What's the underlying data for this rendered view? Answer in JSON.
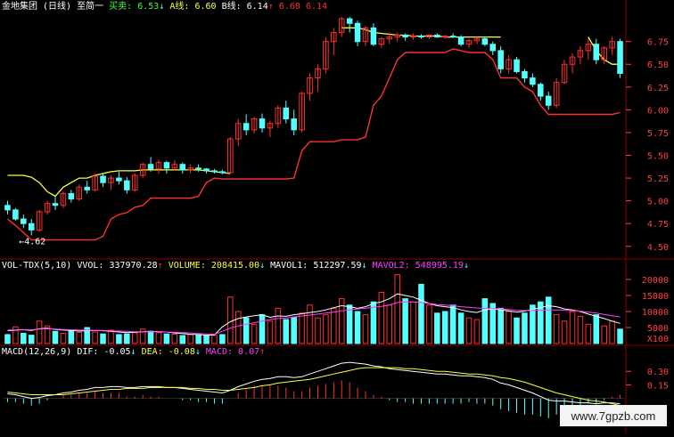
{
  "header": {
    "stock": "金地集团",
    "period": "(日线)",
    "indicator": "至简一",
    "buy_label": "买卖:",
    "buy_value": "6.53",
    "a_label": "A线:",
    "a_value": "6.60",
    "b_label": "B线:",
    "b_value": "6.14",
    "extra1": "6.60",
    "extra2": "6.14"
  },
  "vol_header": {
    "name": "VOL-TDX(5,10)",
    "vvol_label": "VVOL:",
    "vvol_value": "337970.28",
    "volume_label": "VOLUME:",
    "volume_value": "208415.00",
    "mavol1_label": "MAVOL1:",
    "mavol1_value": "512297.59",
    "mavol2_label": "MAVOL2:",
    "mavol2_value": "548995.19"
  },
  "macd_header": {
    "name": "MACD(12,26,9)",
    "dif_label": "DIF:",
    "dif_value": "-0.05",
    "dea_label": "DEA:",
    "dea_value": "-0.08",
    "macd_label": "MACD:",
    "macd_value": "0.07"
  },
  "annotation_low": "4.62",
  "watermark": "www.7gpzb.com",
  "colors": {
    "up": "#ff3030",
    "down": "#54ffff",
    "panel_line": "#8b0000",
    "yellow": "#ffff40",
    "white": "#ffffff",
    "magenta": "#ff40ff",
    "green": "#40ff40",
    "axis_text": "#ff4040"
  },
  "chart_data": [
    {
      "type": "candlestick",
      "panel": "price",
      "yticks": [
        "4.50",
        "4.75",
        "5.00",
        "5.25",
        "5.50",
        "5.75",
        "6.00",
        "6.25",
        "6.50",
        "6.75"
      ],
      "ylim": [
        4.4,
        7.05
      ],
      "ohlc": [
        [
          4.95,
          5.0,
          4.85,
          4.9
        ],
        [
          4.9,
          4.92,
          4.78,
          4.8
        ],
        [
          4.8,
          4.85,
          4.7,
          4.75
        ],
        [
          4.75,
          4.8,
          4.62,
          4.68
        ],
        [
          4.68,
          4.9,
          4.66,
          4.88
        ],
        [
          4.88,
          5.0,
          4.85,
          4.97
        ],
        [
          4.97,
          5.05,
          4.9,
          4.95
        ],
        [
          4.95,
          5.1,
          4.92,
          5.08
        ],
        [
          5.08,
          5.12,
          4.98,
          5.02
        ],
        [
          5.02,
          5.18,
          5.0,
          5.15
        ],
        [
          5.15,
          5.22,
          5.08,
          5.12
        ],
        [
          5.12,
          5.3,
          5.1,
          5.27
        ],
        [
          5.27,
          5.3,
          5.15,
          5.2
        ],
        [
          5.2,
          5.28,
          5.12,
          5.25
        ],
        [
          5.25,
          5.32,
          5.18,
          5.22
        ],
        [
          5.22,
          5.26,
          5.08,
          5.12
        ],
        [
          5.12,
          5.3,
          5.1,
          5.28
        ],
        [
          5.28,
          5.42,
          5.25,
          5.4
        ],
        [
          5.4,
          5.48,
          5.32,
          5.35
        ],
        [
          5.35,
          5.45,
          5.3,
          5.42
        ],
        [
          5.42,
          5.44,
          5.3,
          5.36
        ],
        [
          5.36,
          5.45,
          5.33,
          5.4
        ],
        [
          5.4,
          5.42,
          5.3,
          5.34
        ],
        [
          5.34,
          5.4,
          5.3,
          5.36
        ],
        [
          5.36,
          5.4,
          5.32,
          5.35
        ],
        [
          5.35,
          5.36,
          5.3,
          5.33
        ],
        [
          5.33,
          5.35,
          5.3,
          5.32
        ],
        [
          5.32,
          5.34,
          5.29,
          5.31
        ],
        [
          5.31,
          5.7,
          5.3,
          5.68
        ],
        [
          5.68,
          5.9,
          5.6,
          5.85
        ],
        [
          5.85,
          5.95,
          5.72,
          5.78
        ],
        [
          5.78,
          5.92,
          5.74,
          5.9
        ],
        [
          5.9,
          5.96,
          5.75,
          5.8
        ],
        [
          5.8,
          5.88,
          5.7,
          5.85
        ],
        [
          5.85,
          6.05,
          5.8,
          6.02
        ],
        [
          6.02,
          6.1,
          5.85,
          5.9
        ],
        [
          5.9,
          6.0,
          5.72,
          5.78
        ],
        [
          5.78,
          6.2,
          5.75,
          6.18
        ],
        [
          6.18,
          6.4,
          6.1,
          6.35
        ],
        [
          6.35,
          6.5,
          6.2,
          6.45
        ],
        [
          6.45,
          6.8,
          6.4,
          6.75
        ],
        [
          6.75,
          6.9,
          6.6,
          6.85
        ],
        [
          6.85,
          7.02,
          6.8,
          7.0
        ],
        [
          7.0,
          7.02,
          6.85,
          6.95
        ],
        [
          6.95,
          6.98,
          6.7,
          6.75
        ],
        [
          6.75,
          6.92,
          6.7,
          6.9
        ],
        [
          6.9,
          6.95,
          6.7,
          6.72
        ],
        [
          6.72,
          6.8,
          6.68,
          6.78
        ],
        [
          6.78,
          6.85,
          6.72,
          6.8
        ],
        [
          6.8,
          6.85,
          6.75,
          6.82
        ],
        [
          6.82,
          6.84,
          6.76,
          6.8
        ],
        [
          6.8,
          6.84,
          6.77,
          6.81
        ],
        [
          6.81,
          6.83,
          6.78,
          6.8
        ],
        [
          6.8,
          6.83,
          6.78,
          6.82
        ],
        [
          6.82,
          6.84,
          6.79,
          6.8
        ],
        [
          6.8,
          6.82,
          6.78,
          6.81
        ],
        [
          6.81,
          6.84,
          6.79,
          6.8
        ],
        [
          6.8,
          6.82,
          6.7,
          6.72
        ],
        [
          6.72,
          6.78,
          6.68,
          6.76
        ],
        [
          6.76,
          6.8,
          6.72,
          6.78
        ],
        [
          6.78,
          6.8,
          6.7,
          6.72
        ],
        [
          6.72,
          6.75,
          6.6,
          6.65
        ],
        [
          6.65,
          6.7,
          6.4,
          6.45
        ],
        [
          6.45,
          6.6,
          6.4,
          6.55
        ],
        [
          6.55,
          6.58,
          6.4,
          6.42
        ],
        [
          6.42,
          6.45,
          6.3,
          6.35
        ],
        [
          6.35,
          6.4,
          6.25,
          6.28
        ],
        [
          6.28,
          6.3,
          6.1,
          6.15
        ],
        [
          6.15,
          6.2,
          6.0,
          6.05
        ],
        [
          6.05,
          6.35,
          6.02,
          6.3
        ],
        [
          6.3,
          6.55,
          6.28,
          6.5
        ],
        [
          6.5,
          6.62,
          6.4,
          6.58
        ],
        [
          6.58,
          6.7,
          6.5,
          6.65
        ],
        [
          6.65,
          6.78,
          6.55,
          6.72
        ],
        [
          6.72,
          6.78,
          6.5,
          6.55
        ],
        [
          6.55,
          6.7,
          6.5,
          6.68
        ],
        [
          6.68,
          6.8,
          6.6,
          6.75
        ],
        [
          6.75,
          6.78,
          6.35,
          6.4
        ]
      ],
      "a_line": [
        5.28,
        5.28,
        5.28,
        5.26,
        5.2,
        5.1,
        5.05,
        5.15,
        5.2,
        5.25,
        5.25,
        5.28,
        5.3,
        5.32,
        5.33,
        5.33,
        5.33,
        5.34,
        5.34,
        5.34,
        5.34,
        5.34,
        5.34,
        5.34,
        5.34,
        5.33,
        5.32,
        5.31,
        5.3,
        null,
        null,
        null,
        null,
        null,
        null,
        null,
        null,
        null,
        null,
        null,
        null,
        null,
        6.9,
        6.9,
        6.9,
        6.88,
        6.85,
        6.84,
        6.83,
        6.82,
        6.82,
        6.81,
        6.81,
        6.81,
        6.81,
        6.8,
        6.8,
        6.8,
        6.8,
        6.8,
        6.8,
        6.8,
        6.8,
        null,
        null,
        null,
        null,
        null,
        null,
        null,
        null,
        null,
        null,
        6.8,
        6.65,
        6.55,
        6.5,
        6.5
      ]
    },
    {
      "type": "bar",
      "panel": "volume",
      "yticks": [
        "5000",
        "10000",
        "15000",
        "20000"
      ],
      "ylim": [
        0,
        22500
      ],
      "y_axis_label": "X100",
      "values": [
        2800,
        5200,
        3200,
        2600,
        7000,
        5500,
        3800,
        3200,
        4000,
        3500,
        5000,
        3600,
        3000,
        4200,
        2800,
        3000,
        3400,
        4500,
        3800,
        3400,
        3000,
        2900,
        2500,
        2800,
        2600,
        2400,
        2600,
        2800,
        14500,
        10000,
        8000,
        6000,
        9000,
        7000,
        11000,
        7500,
        8200,
        9500,
        12000,
        8000,
        9000,
        11000,
        14000,
        12000,
        10000,
        9000,
        13000,
        16000,
        12000,
        21500,
        14000,
        13000,
        18500,
        12000,
        9500,
        10000,
        12000,
        9500,
        8000,
        7500,
        14000,
        12500,
        11000,
        10000,
        8000,
        9500,
        12000,
        13000,
        14500,
        9000,
        7000,
        10000,
        8500,
        6000,
        9000,
        5500,
        7000,
        4500
      ],
      "mavol1": [
        4000,
        4200,
        4300,
        4100,
        4600,
        4800,
        4400,
        4200,
        4100,
        3900,
        4000,
        4100,
        4000,
        3800,
        3600,
        3400,
        3500,
        3700,
        3800,
        3700,
        3600,
        3300,
        3100,
        2900,
        2800,
        2600,
        2700,
        5200,
        6800,
        7800,
        8300,
        8700,
        9000,
        8200,
        8600,
        8500,
        9000,
        9300,
        9700,
        10000,
        10500,
        11200,
        11800,
        11500,
        11000,
        11500,
        12500,
        13000,
        14000,
        15500,
        15000,
        14500,
        13500,
        12500,
        11800,
        11500,
        11200,
        10500,
        10000,
        9700,
        10500,
        10800,
        10500,
        10200,
        9800,
        10100,
        10700,
        11200,
        11800,
        11500,
        10800,
        10500,
        10000,
        9200,
        8500,
        7800,
        7000,
        6300
      ],
      "mavol2": [
        4200,
        4300,
        4400,
        4300,
        4500,
        4600,
        4500,
        4400,
        4300,
        4200,
        4200,
        4100,
        4100,
        4000,
        3900,
        3800,
        3700,
        3700,
        3700,
        3700,
        3600,
        3500,
        3400,
        3300,
        3100,
        3000,
        2900,
        3800,
        4800,
        5500,
        6000,
        6500,
        7000,
        7500,
        7800,
        8000,
        8300,
        8600,
        8900,
        9200,
        9500,
        9800,
        10200,
        10500,
        10800,
        11000,
        11300,
        11600,
        12000,
        12800,
        13000,
        13000,
        12800,
        12500,
        12200,
        12000,
        11800,
        11500,
        11300,
        11100,
        11000,
        10900,
        10800,
        10600,
        10400,
        10300,
        10300,
        10400,
        10500,
        10500,
        10400,
        10300,
        10100,
        9800,
        9500,
        9100,
        8700,
        8300
      ],
      "up_flags": [
        0,
        1,
        0,
        0,
        1,
        1,
        0,
        1,
        0,
        1,
        0,
        1,
        0,
        1,
        0,
        0,
        1,
        1,
        0,
        1,
        0,
        1,
        0,
        1,
        0,
        0,
        1,
        0,
        1,
        1,
        0,
        1,
        0,
        1,
        1,
        0,
        0,
        1,
        1,
        1,
        1,
        1,
        1,
        0,
        0,
        1,
        0,
        1,
        1,
        1,
        0,
        1,
        0,
        1,
        0,
        0,
        0,
        0,
        1,
        1,
        0,
        0,
        0,
        1,
        0,
        0,
        0,
        0,
        0,
        1,
        1,
        1,
        1,
        1,
        0,
        1,
        1,
        0
      ]
    },
    {
      "type": "line",
      "panel": "macd",
      "yticks": [
        "0.15",
        "0.30"
      ],
      "ylim": [
        -0.32,
        0.45
      ],
      "dif": [
        0.05,
        0.04,
        0.02,
        0.0,
        0.01,
        0.03,
        0.04,
        0.06,
        0.07,
        0.09,
        0.1,
        0.12,
        0.12,
        0.13,
        0.13,
        0.12,
        0.12,
        0.13,
        0.13,
        0.13,
        0.12,
        0.12,
        0.11,
        0.1,
        0.09,
        0.08,
        0.07,
        0.06,
        0.09,
        0.13,
        0.16,
        0.19,
        0.21,
        0.22,
        0.24,
        0.24,
        0.23,
        0.24,
        0.27,
        0.3,
        0.33,
        0.36,
        0.39,
        0.4,
        0.39,
        0.38,
        0.36,
        0.35,
        0.33,
        0.32,
        0.31,
        0.3,
        0.29,
        0.28,
        0.27,
        0.27,
        0.26,
        0.25,
        0.25,
        0.24,
        0.23,
        0.21,
        0.17,
        0.15,
        0.12,
        0.09,
        0.06,
        0.02,
        -0.02,
        -0.03,
        -0.03,
        -0.04,
        -0.05,
        -0.05,
        -0.06,
        -0.05,
        -0.05,
        -0.06
      ],
      "dea": [
        0.07,
        0.06,
        0.05,
        0.04,
        0.04,
        0.04,
        0.04,
        0.04,
        0.05,
        0.06,
        0.07,
        0.08,
        0.09,
        0.1,
        0.1,
        0.11,
        0.11,
        0.11,
        0.12,
        0.12,
        0.12,
        0.12,
        0.12,
        0.11,
        0.11,
        0.1,
        0.1,
        0.09,
        0.09,
        0.1,
        0.11,
        0.12,
        0.14,
        0.15,
        0.17,
        0.18,
        0.19,
        0.2,
        0.21,
        0.23,
        0.25,
        0.27,
        0.29,
        0.31,
        0.33,
        0.34,
        0.34,
        0.34,
        0.34,
        0.34,
        0.33,
        0.33,
        0.32,
        0.31,
        0.3,
        0.3,
        0.29,
        0.28,
        0.27,
        0.27,
        0.26,
        0.25,
        0.23,
        0.22,
        0.2,
        0.18,
        0.15,
        0.12,
        0.09,
        0.06,
        0.04,
        0.02,
        0.0,
        -0.02,
        -0.03,
        -0.04,
        -0.06,
        -0.08
      ]
    }
  ]
}
